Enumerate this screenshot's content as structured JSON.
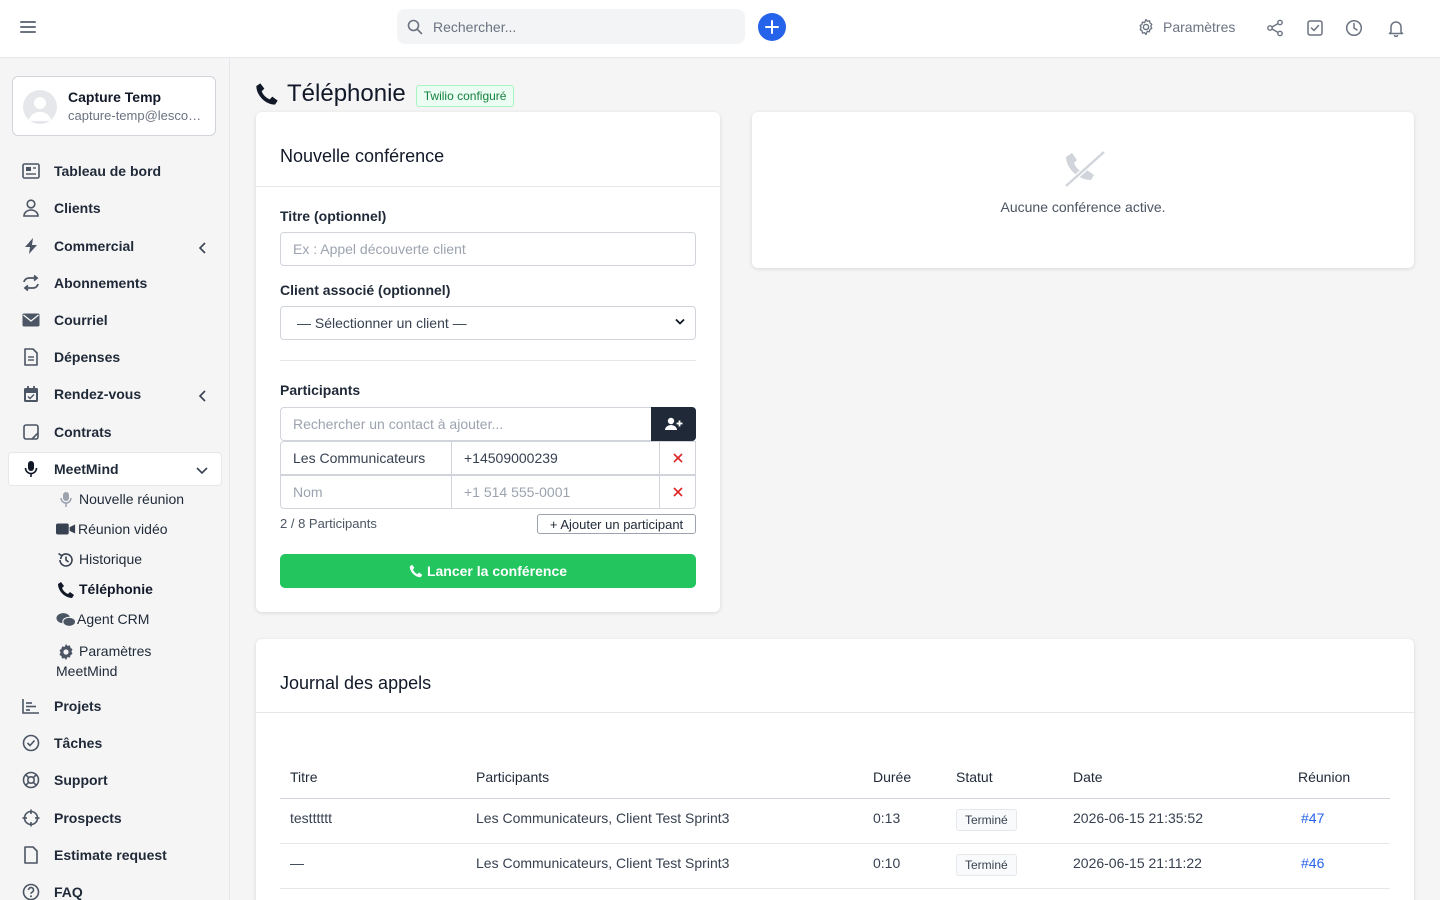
{
  "topbar": {
    "search_placeholder": "Rechercher...",
    "settings_label": "Paramètres"
  },
  "user": {
    "name": "Capture Temp",
    "email": "capture-temp@lescommunicateurs.ca"
  },
  "sidebar": {
    "items": [
      {
        "label": "Tableau de bord",
        "icon": "dashboard-icon"
      },
      {
        "label": "Clients",
        "icon": "user-icon"
      },
      {
        "label": "Commercial",
        "icon": "bolt-icon"
      },
      {
        "label": "Abonnements",
        "icon": "repeat-icon"
      },
      {
        "label": "Courriel",
        "icon": "envelope-icon"
      },
      {
        "label": "Dépenses",
        "icon": "document-icon"
      },
      {
        "label": "Rendez-vous",
        "icon": "calendar-icon"
      },
      {
        "label": "Contrats",
        "icon": "contract-icon"
      },
      {
        "label": "MeetMind",
        "icon": "microphone-icon"
      },
      {
        "label": "Projets",
        "icon": "chart-icon"
      },
      {
        "label": "Tâches",
        "icon": "check-circle-icon"
      },
      {
        "label": "Support",
        "icon": "lifebuoy-icon"
      },
      {
        "label": "Prospects",
        "icon": "crosshair-icon"
      },
      {
        "label": "Estimate request",
        "icon": "file-icon"
      },
      {
        "label": "FAQ",
        "icon": "question-icon"
      }
    ],
    "meetmind_sub": [
      {
        "label": "Nouvelle réunion",
        "icon": "microphone-icon"
      },
      {
        "label": "Réunion vidéo",
        "icon": "video-icon"
      },
      {
        "label": "Historique",
        "icon": "history-icon"
      },
      {
        "label": "Téléphonie",
        "icon": "phone-icon"
      },
      {
        "label": "Agent CRM",
        "icon": "comments-icon"
      },
      {
        "label": "Paramètres",
        "label2": "MeetMind",
        "icon": "gear-icon"
      }
    ]
  },
  "page": {
    "title": "Téléphonie",
    "badge": "Twilio configuré"
  },
  "conference_form": {
    "heading": "Nouvelle conférence",
    "title_label": "Titre (optionnel)",
    "title_placeholder": "Ex : Appel découverte client",
    "client_label": "Client associé (optionnel)",
    "client_selected": "— Sélectionner un client —",
    "participants_label": "Participants",
    "contact_search_placeholder": "Rechercher un contact à ajouter...",
    "participants": [
      {
        "name": "Les Communicateurs",
        "phone": "+14509000239"
      },
      {
        "name_placeholder": "Nom",
        "phone_placeholder": "+1 514 555-0001"
      }
    ],
    "count": "2 / 8 Participants",
    "add_participant": "+ Ajouter un participant",
    "launch": "Lancer la conférence"
  },
  "active_panel": {
    "empty_text": "Aucune conférence active."
  },
  "call_log": {
    "heading": "Journal des appels",
    "columns": [
      "Titre",
      "Participants",
      "Durée",
      "Statut",
      "Date",
      "Réunion"
    ],
    "rows": [
      {
        "title": "testttttt",
        "participants": "Les Communicateurs, Client Test Sprint3",
        "duration": "0:13",
        "status": "Terminé",
        "date": "2026-06-15 21:35:52",
        "meeting": "#47"
      },
      {
        "title": "—",
        "participants": "Les Communicateurs, Client Test Sprint3",
        "duration": "0:10",
        "status": "Terminé",
        "date": "2026-06-15 21:11:22",
        "meeting": "#46"
      }
    ]
  },
  "colors": {
    "accent": "#2563eb",
    "success": "#22c55e",
    "dark": "#1f2937"
  }
}
